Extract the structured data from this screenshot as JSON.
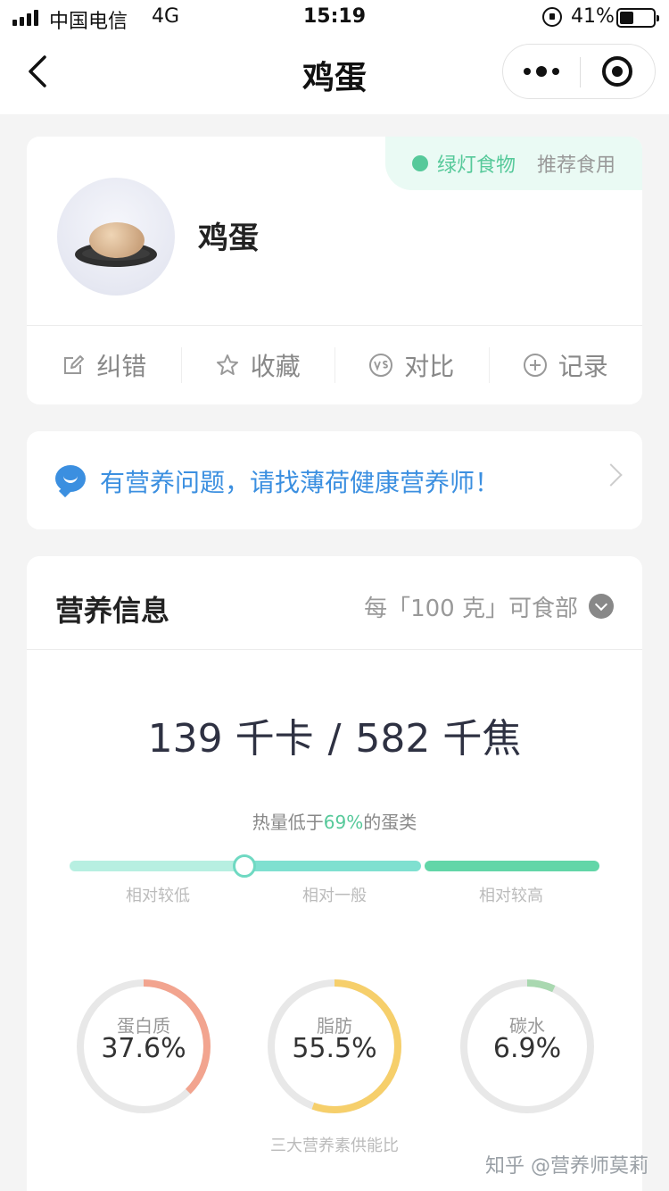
{
  "status_bar": {
    "carrier": "中国电信",
    "network": "4G",
    "time": "15:19",
    "battery": "41%",
    "battery_level": 0.41
  },
  "nav": {
    "title": "鸡蛋",
    "icons": [
      "back-icon",
      "more-icon",
      "close-icon"
    ]
  },
  "food": {
    "name": "鸡蛋",
    "light_label": "绿灯食物",
    "light_hint": "推荐食用",
    "light_color": "#56c99a",
    "actions": [
      {
        "label": "纠错",
        "icon": "edit-icon"
      },
      {
        "label": "收藏",
        "icon": "star-icon"
      },
      {
        "label": "对比",
        "icon": "vs-icon"
      },
      {
        "label": "记录",
        "icon": "plus-icon"
      }
    ]
  },
  "consult": {
    "text": "有营养问题，请找薄荷健康营养师！",
    "color": "#3b8fe0"
  },
  "nutrition": {
    "title": "营养信息",
    "unit": "每「100 克」可食部",
    "kcal": "139 千卡",
    "slash": "/",
    "kj": "582 千焦",
    "compare_prefix": "热量低于",
    "compare_pct": "69%",
    "compare_suffix": "的蛋类",
    "scale_position": 0.33,
    "scale_labels": [
      "相对较低",
      "相对一般",
      "相对较高"
    ],
    "scale_colors": [
      "#b7efe1",
      "#7fe0d0",
      "#62d6a8"
    ],
    "macros": [
      {
        "label": "蛋白质",
        "value": "37.6%",
        "fraction": 0.376,
        "color": "#f2a48f"
      },
      {
        "label": "脂肪",
        "value": "55.5%",
        "fraction": 0.555,
        "color": "#f6cf6b"
      },
      {
        "label": "碳水",
        "value": "6.9%",
        "fraction": 0.069,
        "color": "#a9d8b0"
      }
    ],
    "ratio_caption": "三大营养素供能比"
  },
  "watermark": "知乎 @营养师莫莉"
}
